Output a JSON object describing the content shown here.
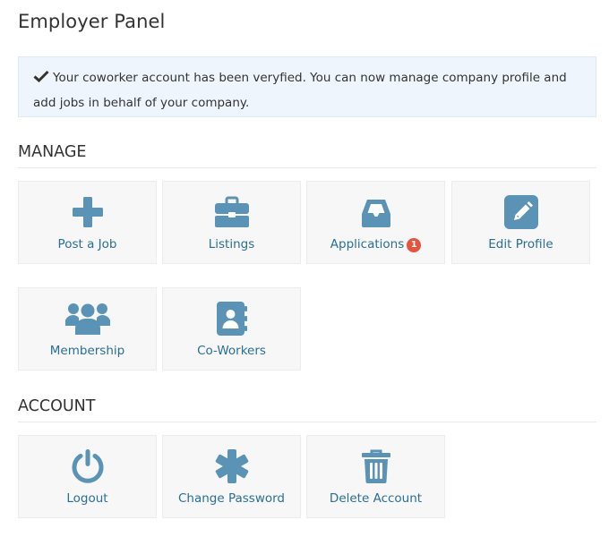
{
  "page": {
    "title": "Employer Panel"
  },
  "alert": {
    "icon": "checkmark-icon",
    "line1": "Your coworker account has been veryfied. You can now manage company profile and",
    "line2": "add jobs in behalf of your company."
  },
  "colors": {
    "icon": "#5a93b5",
    "link": "#2a6f97",
    "badge": "#e8533c",
    "alert_bg": "#eef5fc",
    "tile_bg": "#f7f7f7"
  },
  "manage": {
    "heading": "MANAGE",
    "tiles": [
      {
        "label": "Post a Job",
        "icon": "plus-icon"
      },
      {
        "label": "Listings",
        "icon": "briefcase-icon"
      },
      {
        "label": "Applications",
        "icon": "inbox-icon",
        "badge": "1"
      },
      {
        "label": "Edit Profile",
        "icon": "edit-icon"
      },
      {
        "label": "Membership",
        "icon": "users-icon"
      },
      {
        "label": "Co-Workers",
        "icon": "address-book-icon"
      }
    ]
  },
  "account": {
    "heading": "ACCOUNT",
    "tiles": [
      {
        "label": "Logout",
        "icon": "power-icon"
      },
      {
        "label": "Change Password",
        "icon": "asterisk-icon"
      },
      {
        "label": "Delete Account",
        "icon": "trash-icon"
      }
    ]
  }
}
